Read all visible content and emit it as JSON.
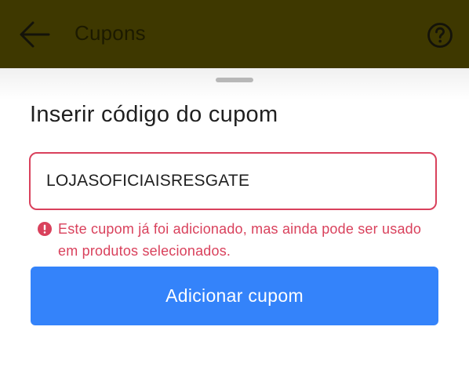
{
  "header": {
    "title": "Cupons",
    "back_icon": "arrow-left-icon",
    "help_icon": "question-circle-icon",
    "background_color": "#3e3800"
  },
  "sheet": {
    "title": "Inserir código do cupom",
    "coupon_input": {
      "value": "LOJASOFICIAISRESGATE"
    },
    "error": {
      "icon": "exclamation-circle-icon",
      "message": "Este cupom já foi adicionado, mas ainda pode ser usado em produtos selecionados.",
      "color": "#d9415c"
    },
    "add_button": {
      "label": "Adicionar cupom",
      "color": "#3483fa"
    }
  }
}
